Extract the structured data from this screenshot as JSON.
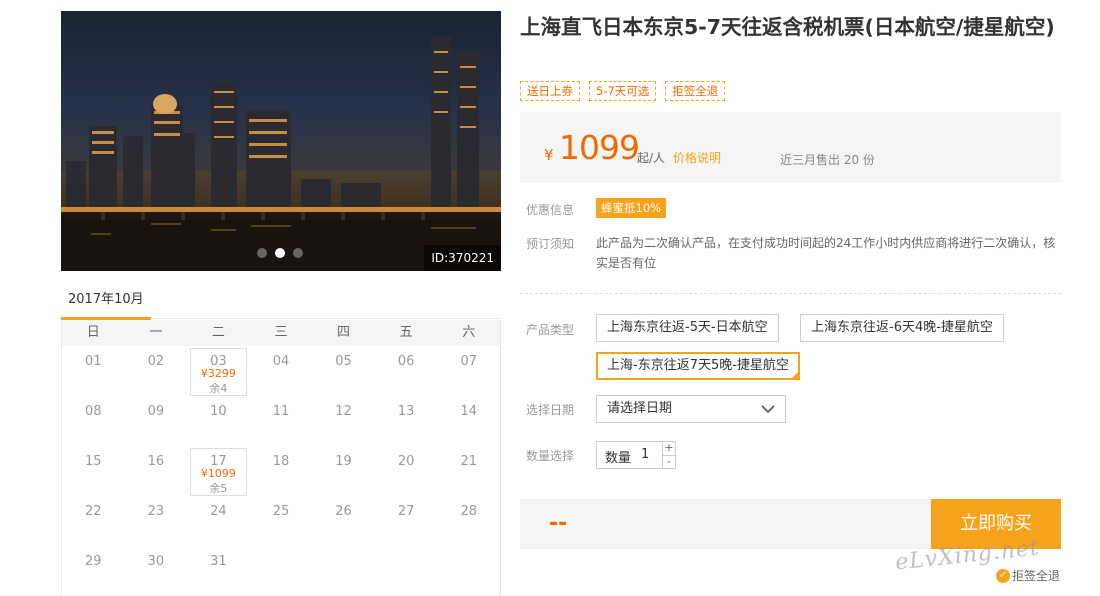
{
  "hero": {
    "image_id": "ID:370221",
    "slides": 3,
    "active_slide": 2
  },
  "calendar": {
    "month_tab": "2017年10月",
    "weekdays": [
      "日",
      "一",
      "二",
      "三",
      "四",
      "五",
      "六"
    ],
    "days": [
      {
        "day": "01"
      },
      {
        "day": "02"
      },
      {
        "day": "03",
        "price": "¥3299",
        "stock": "余4"
      },
      {
        "day": "04"
      },
      {
        "day": "05"
      },
      {
        "day": "06"
      },
      {
        "day": "07"
      },
      {
        "day": "08"
      },
      {
        "day": "09"
      },
      {
        "day": "10"
      },
      {
        "day": "11"
      },
      {
        "day": "12"
      },
      {
        "day": "13"
      },
      {
        "day": "14"
      },
      {
        "day": "15"
      },
      {
        "day": "16"
      },
      {
        "day": "17",
        "price": "¥1099",
        "stock": "余5"
      },
      {
        "day": "18"
      },
      {
        "day": "19"
      },
      {
        "day": "20"
      },
      {
        "day": "21"
      },
      {
        "day": "22"
      },
      {
        "day": "23"
      },
      {
        "day": "24"
      },
      {
        "day": "25"
      },
      {
        "day": "26"
      },
      {
        "day": "27"
      },
      {
        "day": "28"
      },
      {
        "day": "29"
      },
      {
        "day": "30"
      },
      {
        "day": "31"
      }
    ]
  },
  "product": {
    "title": "上海直飞日本东京5-7天往返含税机票(日本航空/捷星航空)",
    "tags": [
      "送日上券",
      "5-7天可选",
      "拒签全退"
    ]
  },
  "price": {
    "currency": "¥",
    "amount": "1099",
    "unit": "起/人",
    "detail_link": "价格说明",
    "sold": "近三月售出 20 份"
  },
  "promo": {
    "label": "优惠信息",
    "badge": "蜂蜜抵10%"
  },
  "notice": {
    "label": "预订须知",
    "text": "此产品为二次确认产品，在支付成功时间起的24工作小时内供应商将进行二次确认，核实是否有位"
  },
  "options": {
    "label": "产品类型",
    "items": [
      "上海东京往返-5天-日本航空",
      "上海东京往返-6天4晚-捷星航空",
      "上海-东京往返7天5晚-捷星航空"
    ],
    "selected_index": 2
  },
  "date_select": {
    "label": "选择日期",
    "value": "请选择日期"
  },
  "quantity": {
    "label": "数量选择",
    "field_label": "数量",
    "value": "1",
    "plus": "+",
    "minus": "-"
  },
  "buy": {
    "total": "--",
    "button": "立即购买"
  },
  "watermark": "eLvXing.net",
  "refund_note": "拒签全退",
  "colors": {
    "accent": "#f7a21b",
    "price": "#f06a00",
    "panel": "#f5f5f5"
  }
}
